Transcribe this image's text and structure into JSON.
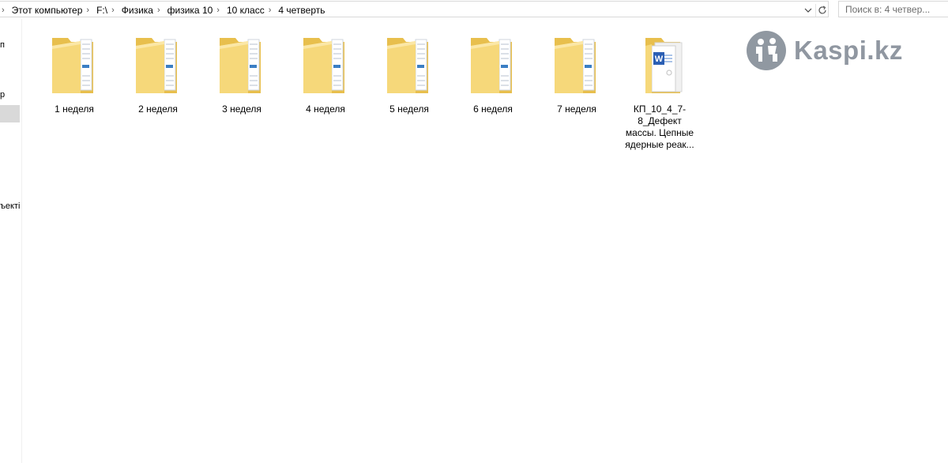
{
  "address_bar": {
    "crumbs": [
      "Этот компьютер",
      "F:\\",
      "Физика",
      "физика 10",
      "10 класс",
      "4 четверть"
    ],
    "dropdown_icon": "chevron-down-icon",
    "refresh_icon": "refresh-icon"
  },
  "search": {
    "placeholder": "Поиск в: 4 четвер..."
  },
  "nav_pane": {
    "fragments": [
      "п",
      "р",
      "ъекті"
    ]
  },
  "items": [
    {
      "label": "1 неделя",
      "type": "folder"
    },
    {
      "label": "2 неделя",
      "type": "folder"
    },
    {
      "label": "3 неделя",
      "type": "folder"
    },
    {
      "label": "4 неделя",
      "type": "folder"
    },
    {
      "label": "5 неделя",
      "type": "folder"
    },
    {
      "label": "6 неделя",
      "type": "folder"
    },
    {
      "label": "7 неделя",
      "type": "folder"
    },
    {
      "label": "КП_10_4_7-8_Дефект массы. Цепные ядерные реак...",
      "type": "word-document"
    }
  ],
  "watermark": {
    "text": "Kaspi.kz",
    "color": "#7d8691"
  },
  "colors": {
    "folder": "#f6d87a",
    "folder_dark": "#e8bf4d",
    "word_blue": "#2b5fb4"
  }
}
